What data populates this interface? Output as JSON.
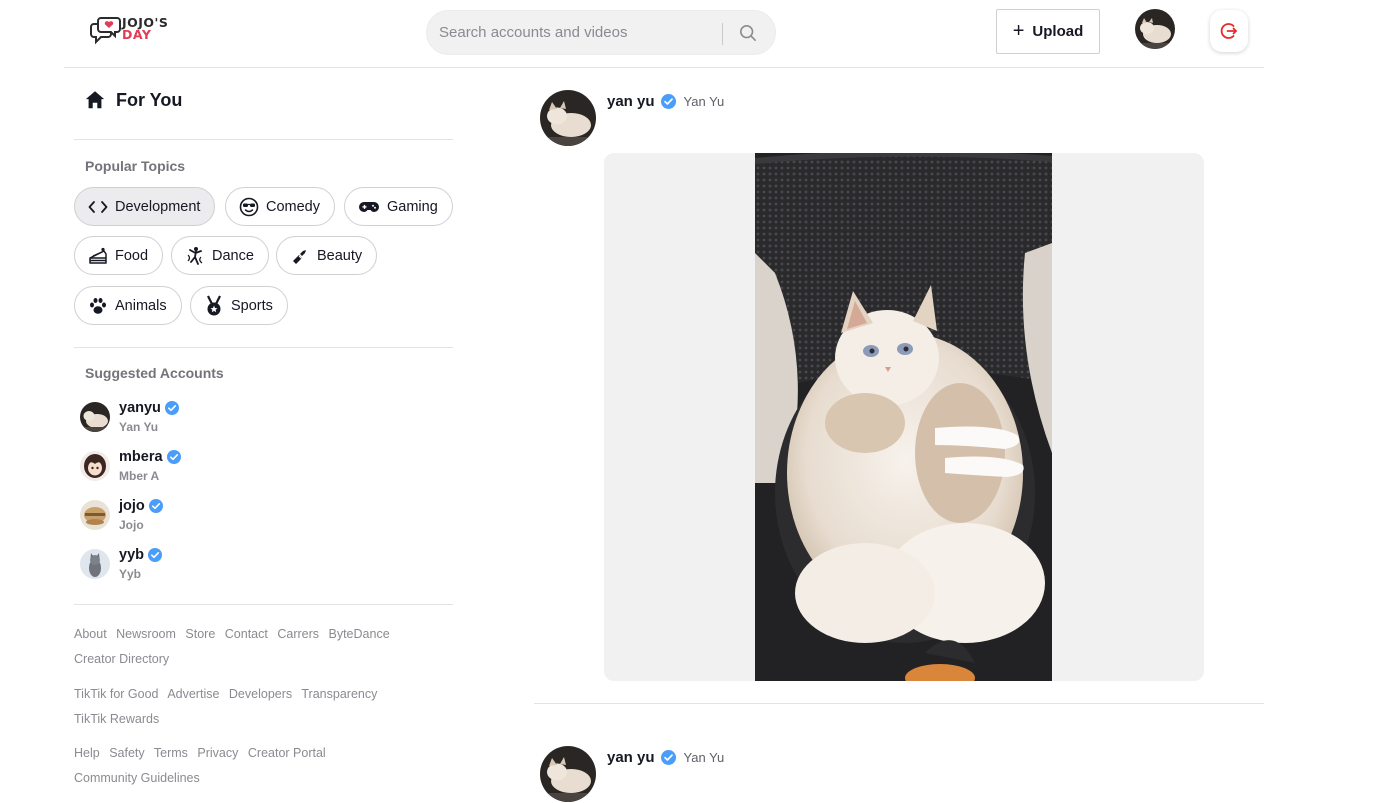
{
  "app": {
    "logo_line1": "JOJO'S",
    "logo_line2": "DAY",
    "colors": {
      "accent": "#fe2c55",
      "verified": "#4a9df8",
      "logout": "#e8282b"
    }
  },
  "header": {
    "search_placeholder": "Search accounts and videos",
    "upload_label": "Upload",
    "icons": [
      "search-icon",
      "plus-icon",
      "logout-icon"
    ]
  },
  "sidebar": {
    "for_you_label": "For You",
    "popular_topics_title": "Popular Topics",
    "topics": [
      {
        "label": "Development",
        "icon": "code-icon",
        "active": true
      },
      {
        "label": "Comedy",
        "icon": "sunglasses-face-icon"
      },
      {
        "label": "Gaming",
        "icon": "gamepad-icon"
      },
      {
        "label": "Food",
        "icon": "cake-icon"
      },
      {
        "label": "Dance",
        "icon": "dancer-icon"
      },
      {
        "label": "Beauty",
        "icon": "lipstick-icon"
      },
      {
        "label": "Animals",
        "icon": "paw-icon"
      },
      {
        "label": "Sports",
        "icon": "medal-icon"
      }
    ],
    "suggested_title": "Suggested Accounts",
    "accounts": [
      {
        "username": "yanyu",
        "display": "Yan Yu",
        "verified": true
      },
      {
        "username": "mbera",
        "display": "Mber A",
        "verified": true
      },
      {
        "username": "jojo",
        "display": "Jojo",
        "verified": true
      },
      {
        "username": "yyb",
        "display": "Yyb",
        "verified": true
      }
    ],
    "footer": {
      "row1": [
        "About",
        "Newsroom",
        "Store",
        "Contact",
        "Carrers",
        "ByteDance"
      ],
      "row1b": [
        "Creator Directory"
      ],
      "row2": [
        "TikTik for Good",
        "Advertise",
        "Developers",
        "Transparency"
      ],
      "row2b": [
        "TikTik Rewards"
      ],
      "row3": [
        "Help",
        "Safety",
        "Terms",
        "Privacy",
        "Creator Portal"
      ],
      "row3b": [
        "Community Guidelines"
      ]
    }
  },
  "feed": {
    "posts": [
      {
        "username": "yan yu",
        "display": "Yan Yu",
        "verified": true
      },
      {
        "username": "yan yu",
        "display": "Yan Yu",
        "verified": true
      }
    ]
  }
}
